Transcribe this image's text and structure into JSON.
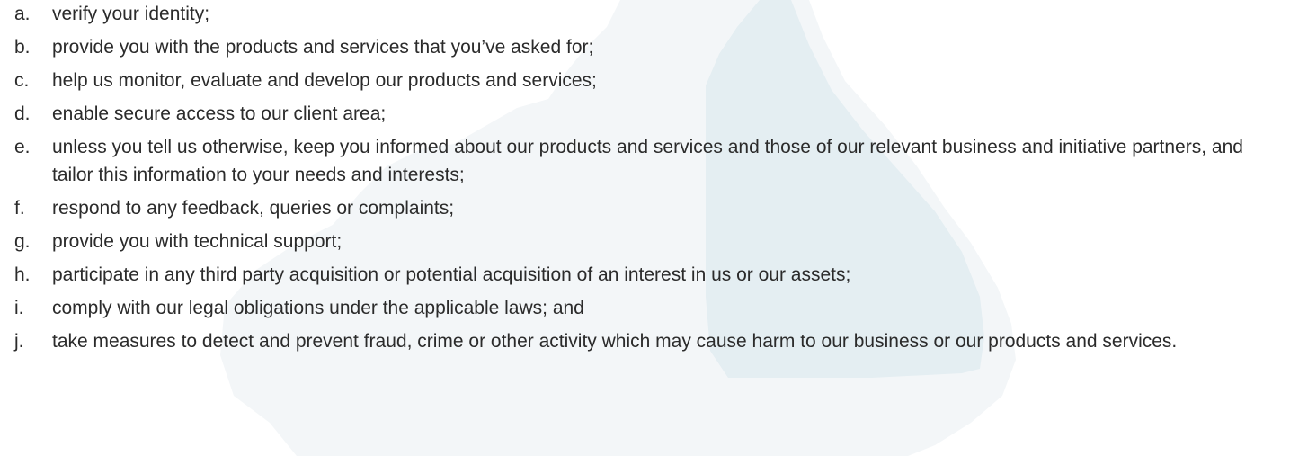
{
  "colors": {
    "text": "#2b2b2b",
    "watermark_light": "#f3f6f8",
    "watermark_blue": "#e4eef2"
  },
  "list": {
    "items": [
      {
        "marker": "a.",
        "text": "verify your identity;"
      },
      {
        "marker": "b.",
        "text": "provide you with the products and services that you’ve asked for;"
      },
      {
        "marker": "c.",
        "text": "help us monitor, evaluate and develop our products and services;"
      },
      {
        "marker": "d.",
        "text": "enable secure access to our client area;"
      },
      {
        "marker": "e.",
        "text": "unless you tell us otherwise, keep you informed about our products and services and those of our relevant business and initiative partners, and tailor this information to your needs and interests;"
      },
      {
        "marker": "f.",
        "text": "respond to any feedback, queries or complaints;"
      },
      {
        "marker": "g.",
        "text": "provide you with technical support;"
      },
      {
        "marker": "h.",
        "text": "participate in any third party acquisition or potential acquisition of an interest in us or our assets;"
      },
      {
        "marker": "i.",
        "text": "comply with our legal obligations under the applicable laws; and"
      },
      {
        "marker": "j.",
        "text": "take measures to detect and prevent fraud, crime or other activity which may cause harm to our business or our products and services."
      }
    ]
  }
}
